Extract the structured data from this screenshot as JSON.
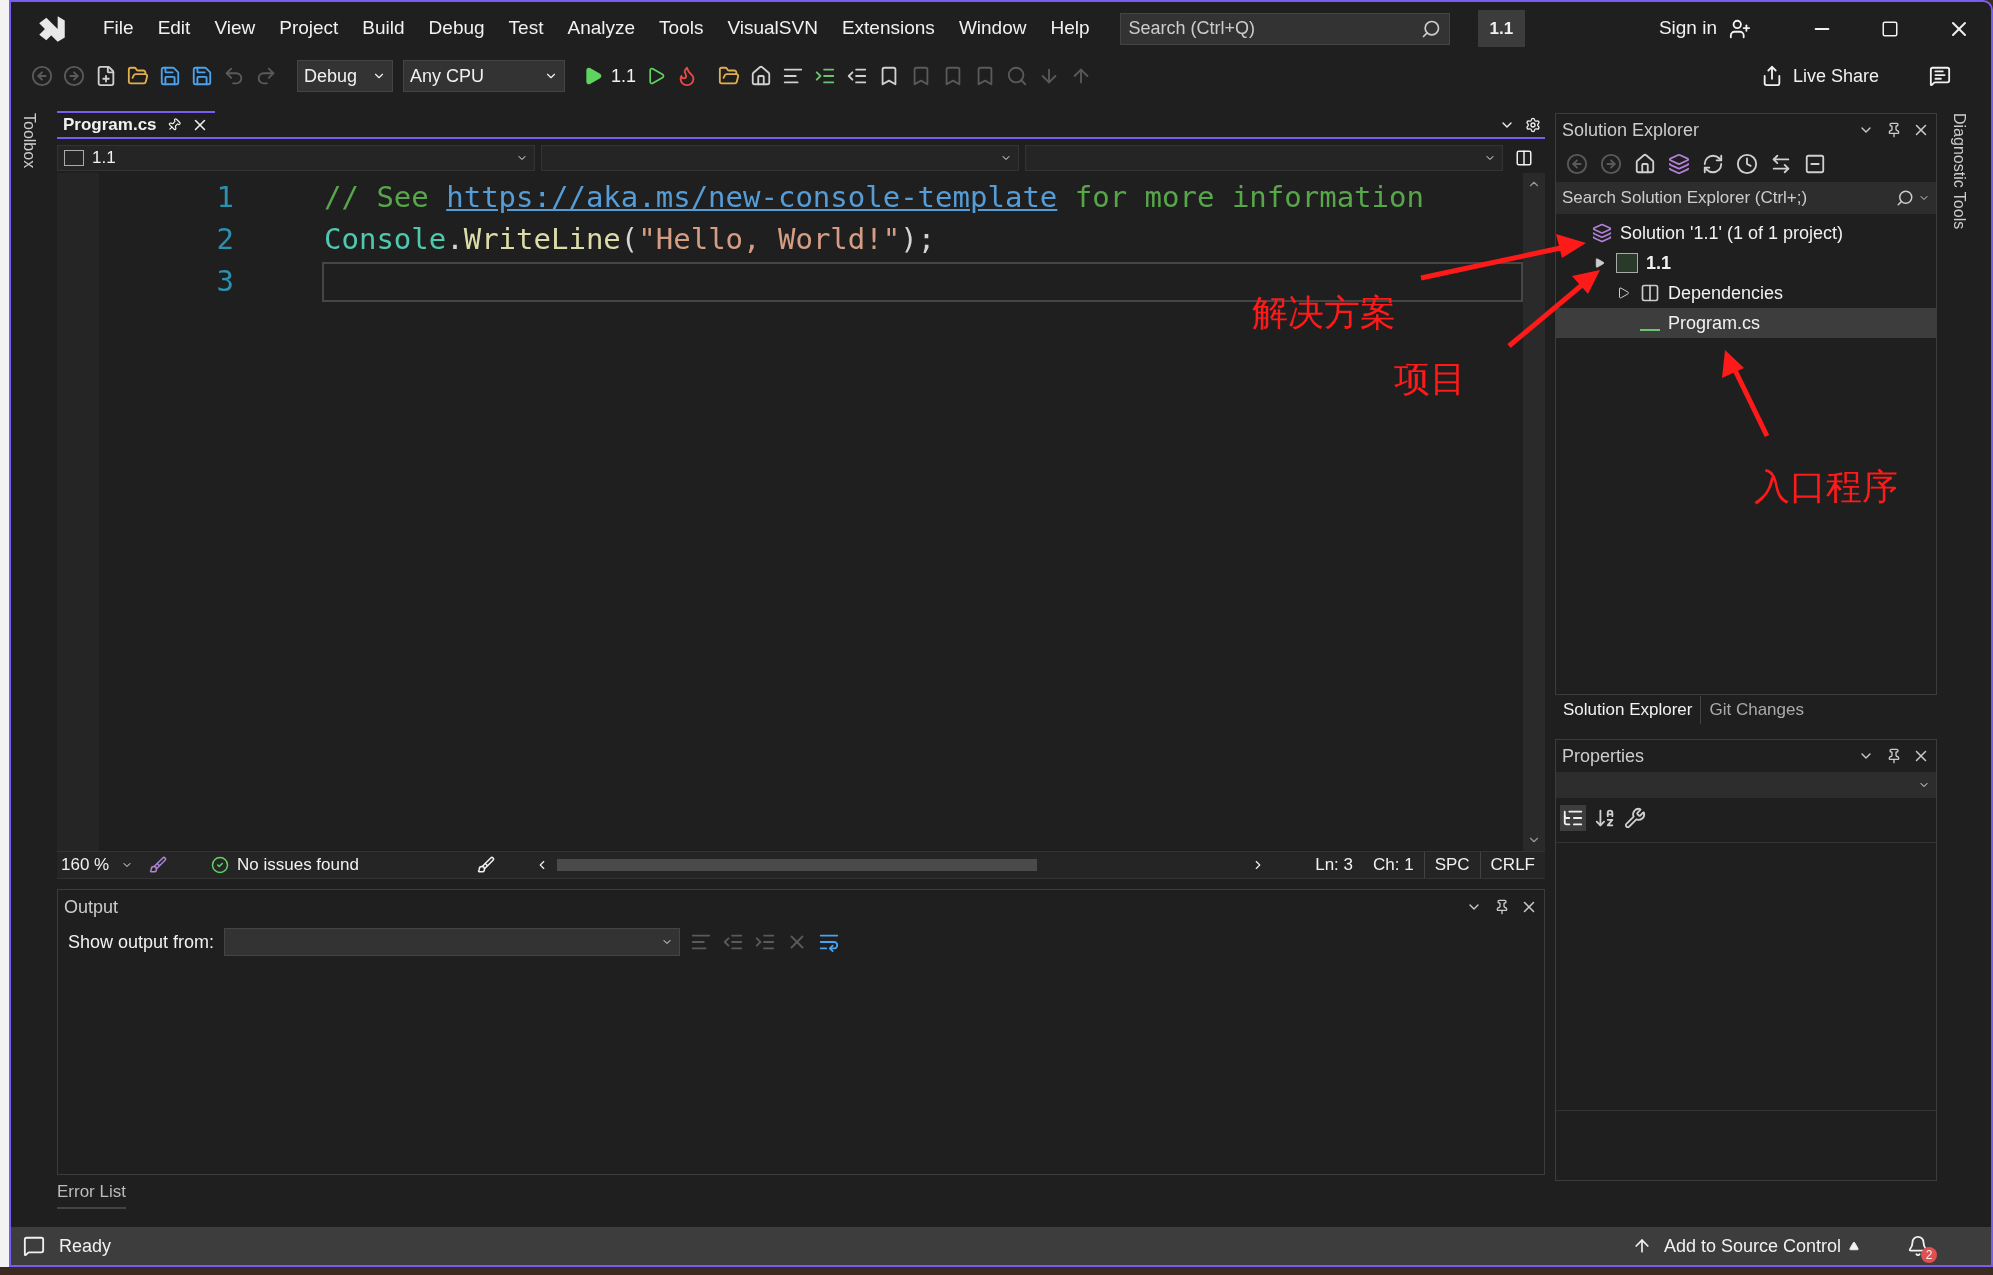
{
  "title_bar": {
    "menu": [
      "File",
      "Edit",
      "View",
      "Project",
      "Build",
      "Debug",
      "Test",
      "Analyze",
      "Tools",
      "VisualSVN",
      "Extensions",
      "Window",
      "Help"
    ],
    "search": {
      "placeholder": "Search (Ctrl+Q)"
    },
    "solution_badge": "1.1",
    "sign_in": "Sign in"
  },
  "toolbar": {
    "configuration": "Debug",
    "platform": "Any CPU",
    "start_target": "1.1",
    "live_share": "Live Share"
  },
  "side_strips": {
    "left": "Toolbox",
    "right": "Diagnostic Tools"
  },
  "editor": {
    "tabs": [
      {
        "label": "Program.cs",
        "selected": true
      }
    ],
    "nav_project": "1.1",
    "lines": [
      {
        "number": "1",
        "current": false,
        "tokens": [
          {
            "kind": "comment",
            "text": "// See "
          },
          {
            "kind": "link",
            "text": "https://aka.ms/new-console-template"
          },
          {
            "kind": "comment",
            "text": " for more information"
          }
        ]
      },
      {
        "number": "2",
        "current": false,
        "tokens": [
          {
            "kind": "type",
            "text": "Console"
          },
          {
            "kind": "plain",
            "text": "."
          },
          {
            "kind": "method",
            "text": "WriteLine"
          },
          {
            "kind": "plain",
            "text": "("
          },
          {
            "kind": "string",
            "text": "\"Hello, World!\""
          },
          {
            "kind": "plain",
            "text": ");"
          }
        ]
      },
      {
        "number": "3",
        "current": true
      }
    ],
    "zoom": "160 %",
    "issues": "No issues found",
    "line": "Ln: 3",
    "column": "Ch: 1",
    "whitespace": "SPC",
    "line_ending": "CRLF"
  },
  "output": {
    "title": "Output",
    "source_label": "Show output from:"
  },
  "bottom_tabs": [
    {
      "label": "Error List"
    }
  ],
  "solution_explorer": {
    "title": "Solution Explorer",
    "search": {
      "placeholder": "Search Solution Explorer (Ctrl+;)"
    },
    "tree": [
      {
        "kind": "solution",
        "label": "Solution '1.1' (1 of 1 project)",
        "selected": false,
        "children": [
          {
            "kind": "project",
            "label": "1.1",
            "selected": false,
            "expanded": true,
            "children": [
              {
                "kind": "dependencies",
                "label": "Dependencies",
                "selected": false,
                "expanded": false
              },
              {
                "kind": "file",
                "label": "Program.cs",
                "selected": true
              }
            ]
          }
        ]
      }
    ],
    "tabs": [
      {
        "label": "Solution Explorer",
        "selected": true
      },
      {
        "label": "Git Changes",
        "selected": false
      }
    ]
  },
  "properties": {
    "title": "Properties"
  },
  "status_bar": {
    "status": "Ready",
    "source_control": "Add to Source Control",
    "notifications": "2"
  },
  "annotations": [
    {
      "text": "解决方案"
    },
    {
      "text": "项目"
    },
    {
      "text": "入口程序"
    }
  ]
}
